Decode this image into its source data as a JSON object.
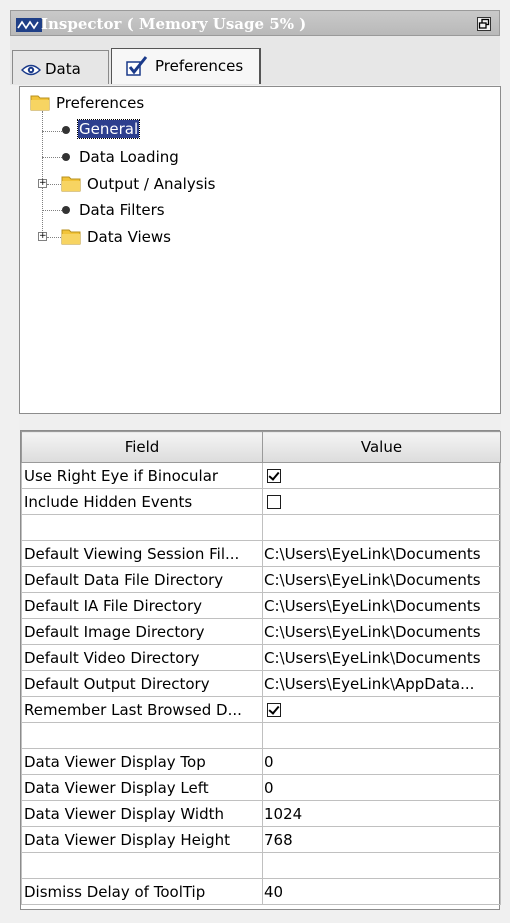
{
  "window": {
    "title": "Inspector ( Memory Usage 5% )"
  },
  "tabs": [
    {
      "label": "Data",
      "icon": "eye-icon"
    },
    {
      "label": "Preferences",
      "icon": "checkbox-icon"
    }
  ],
  "tree": {
    "root": "Preferences",
    "items": [
      {
        "label": "General",
        "type": "leaf",
        "selected": true
      },
      {
        "label": "Data Loading",
        "type": "leaf"
      },
      {
        "label": "Output / Analysis",
        "type": "folder",
        "expandable": true
      },
      {
        "label": "Data Filters",
        "type": "leaf"
      },
      {
        "label": "Data Views",
        "type": "folder",
        "expandable": true
      }
    ]
  },
  "table": {
    "headers": [
      "Field",
      "Value"
    ],
    "rows": [
      {
        "field": "Use Right Eye if Binocular",
        "type": "checkbox",
        "checked": true,
        "value": ""
      },
      {
        "field": "Include Hidden Events",
        "type": "checkbox",
        "checked": false,
        "value": ""
      },
      {
        "field": "",
        "type": "blank",
        "value": ""
      },
      {
        "field": "Default Viewing Session Fil...",
        "type": "text",
        "value": "C:\\Users\\EyeLink\\Documents"
      },
      {
        "field": "Default Data File Directory",
        "type": "text",
        "value": "C:\\Users\\EyeLink\\Documents"
      },
      {
        "field": "Default IA File Directory",
        "type": "text",
        "value": "C:\\Users\\EyeLink\\Documents"
      },
      {
        "field": "Default Image Directory",
        "type": "text",
        "value": "C:\\Users\\EyeLink\\Documents"
      },
      {
        "field": "Default Video Directory",
        "type": "text",
        "value": "C:\\Users\\EyeLink\\Documents"
      },
      {
        "field": "Default Output Directory",
        "type": "text",
        "value": "C:\\Users\\EyeLink\\AppData..."
      },
      {
        "field": "Remember Last Browsed D...",
        "type": "checkbox",
        "checked": true,
        "value": ""
      },
      {
        "field": "",
        "type": "blank",
        "value": ""
      },
      {
        "field": "Data Viewer Display Top",
        "type": "text",
        "value": "0"
      },
      {
        "field": "Data Viewer Display Left",
        "type": "text",
        "value": "0"
      },
      {
        "field": "Data Viewer Display Width",
        "type": "text",
        "value": "1024"
      },
      {
        "field": "Data Viewer Display Height",
        "type": "text",
        "value": "768"
      },
      {
        "field": "",
        "type": "blank",
        "value": ""
      },
      {
        "field": "Dismiss Delay of ToolTip",
        "type": "text",
        "value": "40"
      }
    ]
  },
  "colors": {
    "selection": "#2d3f8e",
    "folder": "#f2c43a",
    "titlebar": "#c0c0c0"
  }
}
